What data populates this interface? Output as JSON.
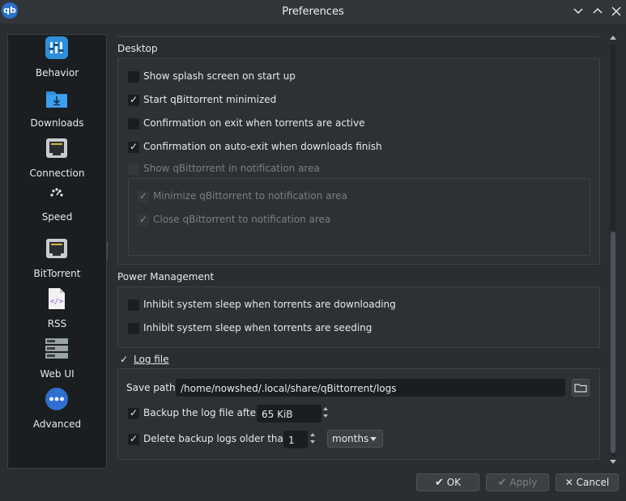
{
  "window": {
    "title": "Preferences",
    "app_icon_text": "qb"
  },
  "sidebar": {
    "items": [
      {
        "label": "Behavior",
        "icon": "behavior-icon"
      },
      {
        "label": "Downloads",
        "icon": "downloads-icon"
      },
      {
        "label": "Connection",
        "icon": "connection-icon"
      },
      {
        "label": "Speed",
        "icon": "speed-icon"
      },
      {
        "label": "BitTorrent",
        "icon": "bittorrent-icon"
      },
      {
        "label": "RSS",
        "icon": "rss-icon"
      },
      {
        "label": "Web UI",
        "icon": "webui-icon"
      },
      {
        "label": "Advanced",
        "icon": "advanced-icon"
      }
    ],
    "active": "Behavior"
  },
  "desktop": {
    "title": "Desktop",
    "options": [
      {
        "label": "Show splash screen on start up",
        "checked": false
      },
      {
        "label": "Start qBittorrent minimized",
        "checked": true
      },
      {
        "label": "Confirmation on exit when torrents are active",
        "checked": false
      },
      {
        "label": "Confirmation on auto-exit when downloads finish",
        "checked": true
      },
      {
        "label": "Show qBittorrent in notification area",
        "checked": false,
        "disabled": true
      }
    ],
    "tray": [
      {
        "label": "Minimize qBittorrent to notification area",
        "checked": true,
        "disabled": true
      },
      {
        "label": "Close qBittorrent to notification area",
        "checked": true,
        "disabled": true
      }
    ]
  },
  "power": {
    "title": "Power Management",
    "options": [
      {
        "label": "Inhibit system sleep when torrents are downloading",
        "checked": false
      },
      {
        "label": "Inhibit system sleep when torrents are seeding",
        "checked": false
      }
    ]
  },
  "log": {
    "title": "Log file",
    "checked": true,
    "save_path_label": "Save path:",
    "save_path": "/home/nowshed/.local/share/qBittorrent/logs",
    "backup_label": "Backup the log file after:",
    "backup_checked": true,
    "backup_value": "65 KiB",
    "delete_label": "Delete backup logs older than:",
    "delete_checked": true,
    "delete_value": "1",
    "delete_unit": "months"
  },
  "buttons": {
    "ok": "OK",
    "apply": "Apply",
    "cancel": "Cancel"
  },
  "colors": {
    "accent": "#3daee9",
    "background": "#2a2e32"
  }
}
